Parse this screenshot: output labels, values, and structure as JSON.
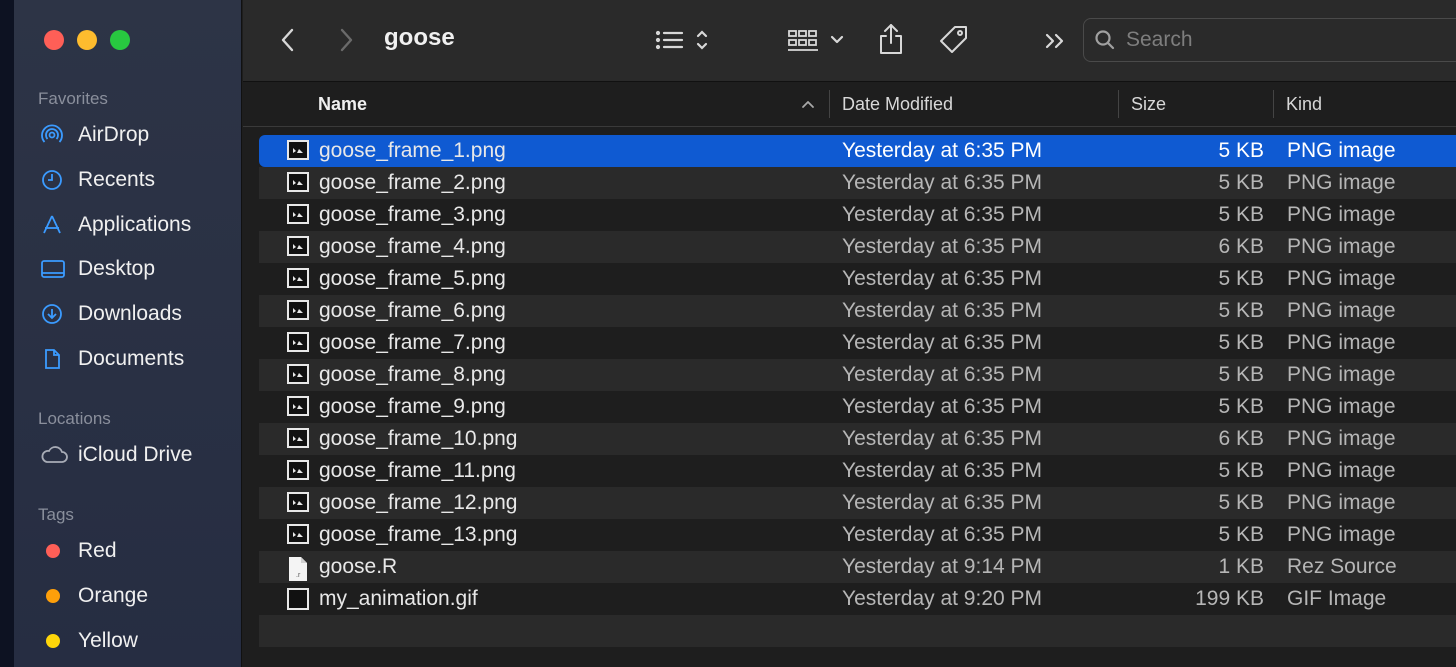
{
  "window": {
    "title": "goose"
  },
  "sidebar": {
    "favorites_label": "Favorites",
    "favorites": [
      {
        "label": "AirDrop",
        "icon": "airdrop-icon"
      },
      {
        "label": "Recents",
        "icon": "clock-icon"
      },
      {
        "label": "Applications",
        "icon": "applications-icon"
      },
      {
        "label": "Desktop",
        "icon": "desktop-icon"
      },
      {
        "label": "Downloads",
        "icon": "download-icon"
      },
      {
        "label": "Documents",
        "icon": "document-icon"
      }
    ],
    "locations_label": "Locations",
    "locations": [
      {
        "label": "iCloud Drive",
        "icon": "cloud-icon"
      }
    ],
    "tags_label": "Tags",
    "tags": [
      {
        "label": "Red",
        "color": "#fe5f57"
      },
      {
        "label": "Orange",
        "color": "#fe9f0a"
      },
      {
        "label": "Yellow",
        "color": "#fed60a"
      }
    ]
  },
  "toolbar": {
    "icons": [
      "back-icon",
      "forward-icon",
      "list-view-icon",
      "group-icon",
      "share-icon",
      "tag-icon",
      "more-icon",
      "search-icon"
    ],
    "search_placeholder": "Search"
  },
  "columns": {
    "name": "Name",
    "date": "Date Modified",
    "size": "Size",
    "kind": "Kind"
  },
  "files": [
    {
      "name": "goose_frame_1.png",
      "date": "Yesterday at 6:35 PM",
      "size": "5 KB",
      "kind": "PNG image",
      "selected": true
    },
    {
      "name": "goose_frame_2.png",
      "date": "Yesterday at 6:35 PM",
      "size": "5 KB",
      "kind": "PNG image"
    },
    {
      "name": "goose_frame_3.png",
      "date": "Yesterday at 6:35 PM",
      "size": "5 KB",
      "kind": "PNG image"
    },
    {
      "name": "goose_frame_4.png",
      "date": "Yesterday at 6:35 PM",
      "size": "6 KB",
      "kind": "PNG image"
    },
    {
      "name": "goose_frame_5.png",
      "date": "Yesterday at 6:35 PM",
      "size": "5 KB",
      "kind": "PNG image"
    },
    {
      "name": "goose_frame_6.png",
      "date": "Yesterday at 6:35 PM",
      "size": "5 KB",
      "kind": "PNG image"
    },
    {
      "name": "goose_frame_7.png",
      "date": "Yesterday at 6:35 PM",
      "size": "5 KB",
      "kind": "PNG image"
    },
    {
      "name": "goose_frame_8.png",
      "date": "Yesterday at 6:35 PM",
      "size": "5 KB",
      "kind": "PNG image"
    },
    {
      "name": "goose_frame_9.png",
      "date": "Yesterday at 6:35 PM",
      "size": "5 KB",
      "kind": "PNG image"
    },
    {
      "name": "goose_frame_10.png",
      "date": "Yesterday at 6:35 PM",
      "size": "6 KB",
      "kind": "PNG image"
    },
    {
      "name": "goose_frame_11.png",
      "date": "Yesterday at 6:35 PM",
      "size": "5 KB",
      "kind": "PNG image"
    },
    {
      "name": "goose_frame_12.png",
      "date": "Yesterday at 6:35 PM",
      "size": "5 KB",
      "kind": "PNG image"
    },
    {
      "name": "goose_frame_13.png",
      "date": "Yesterday at 6:35 PM",
      "size": "5 KB",
      "kind": "PNG image"
    },
    {
      "name": "goose.R",
      "date": "Yesterday at 9:14 PM",
      "size": "1 KB",
      "kind": "Rez Source"
    },
    {
      "name": "my_animation.gif",
      "date": "Yesterday at 9:20 PM",
      "size": "199 KB",
      "kind": "GIF Image"
    }
  ],
  "colors": {
    "accent": "#0f5ad2",
    "sidebar_icon": "#3b9bff"
  }
}
